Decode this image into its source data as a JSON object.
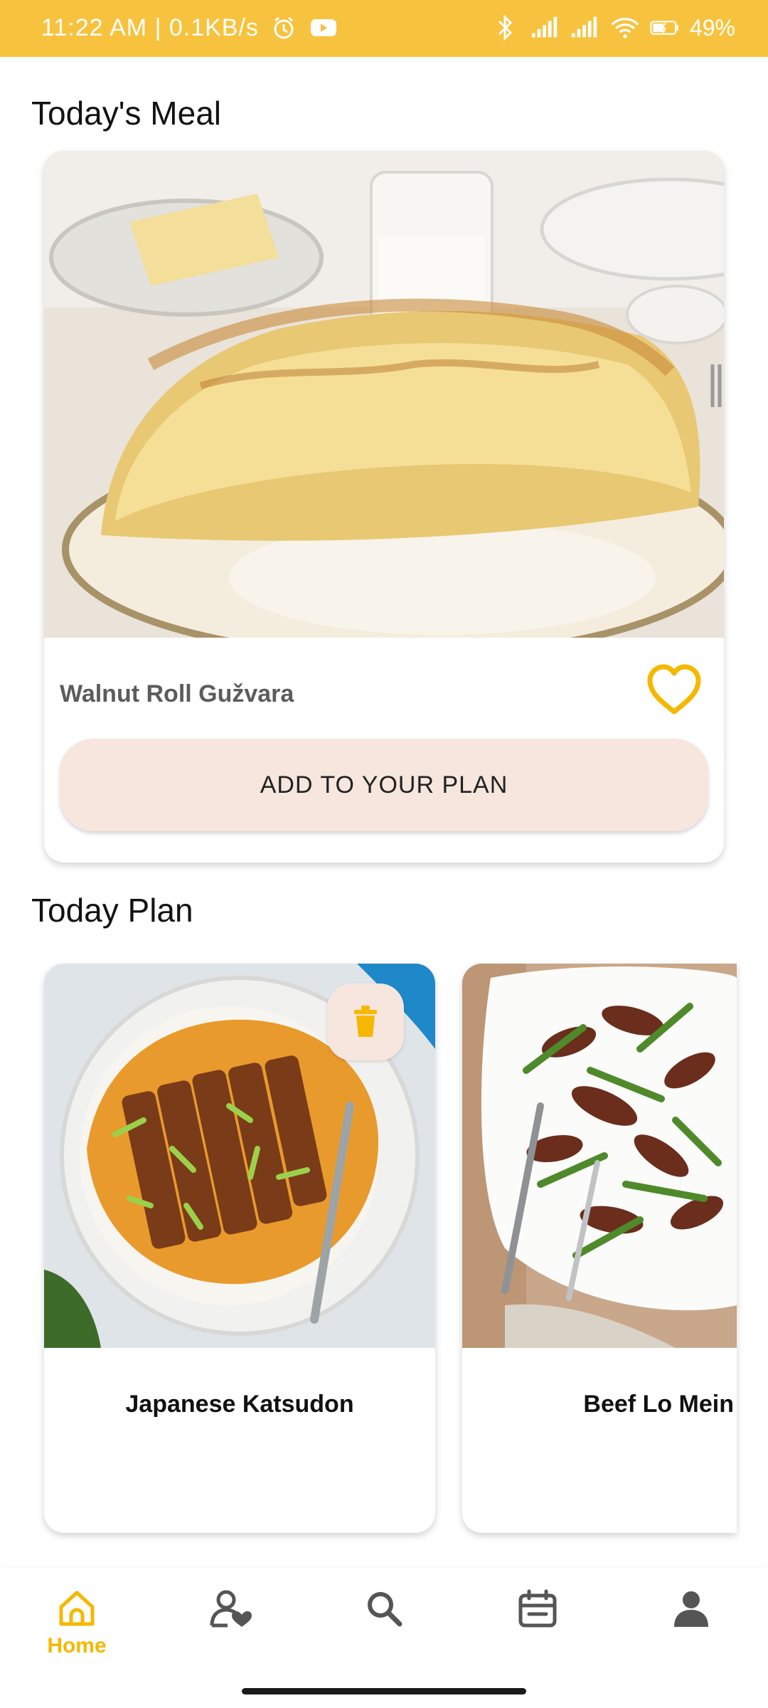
{
  "status_bar": {
    "time_speed": "11:22 AM | 0.1KB/s",
    "battery": "49%",
    "icons": [
      "alarm-icon",
      "youtube-icon",
      "bluetooth-icon",
      "signal-icon",
      "signal-icon",
      "wifi-icon",
      "battery-icon"
    ]
  },
  "todays_meal": {
    "heading": "Today's Meal",
    "name": "Walnut Roll Gužvara",
    "add_label": "ADD TO YOUR PLAN"
  },
  "today_plan": {
    "heading": "Today Plan",
    "items": [
      {
        "name": "Japanese Katsudon"
      },
      {
        "name": "Beef Lo Mein"
      }
    ]
  },
  "nav": {
    "items": [
      {
        "label": "Home",
        "icon": "home-icon",
        "active": true
      },
      {
        "icon": "favorites-user-icon"
      },
      {
        "icon": "search-icon"
      },
      {
        "icon": "calendar-icon"
      },
      {
        "icon": "profile-icon"
      }
    ]
  },
  "colors": {
    "accent": "#f7c23e",
    "active": "#f5b800",
    "button_bg": "#f6e6dd"
  }
}
